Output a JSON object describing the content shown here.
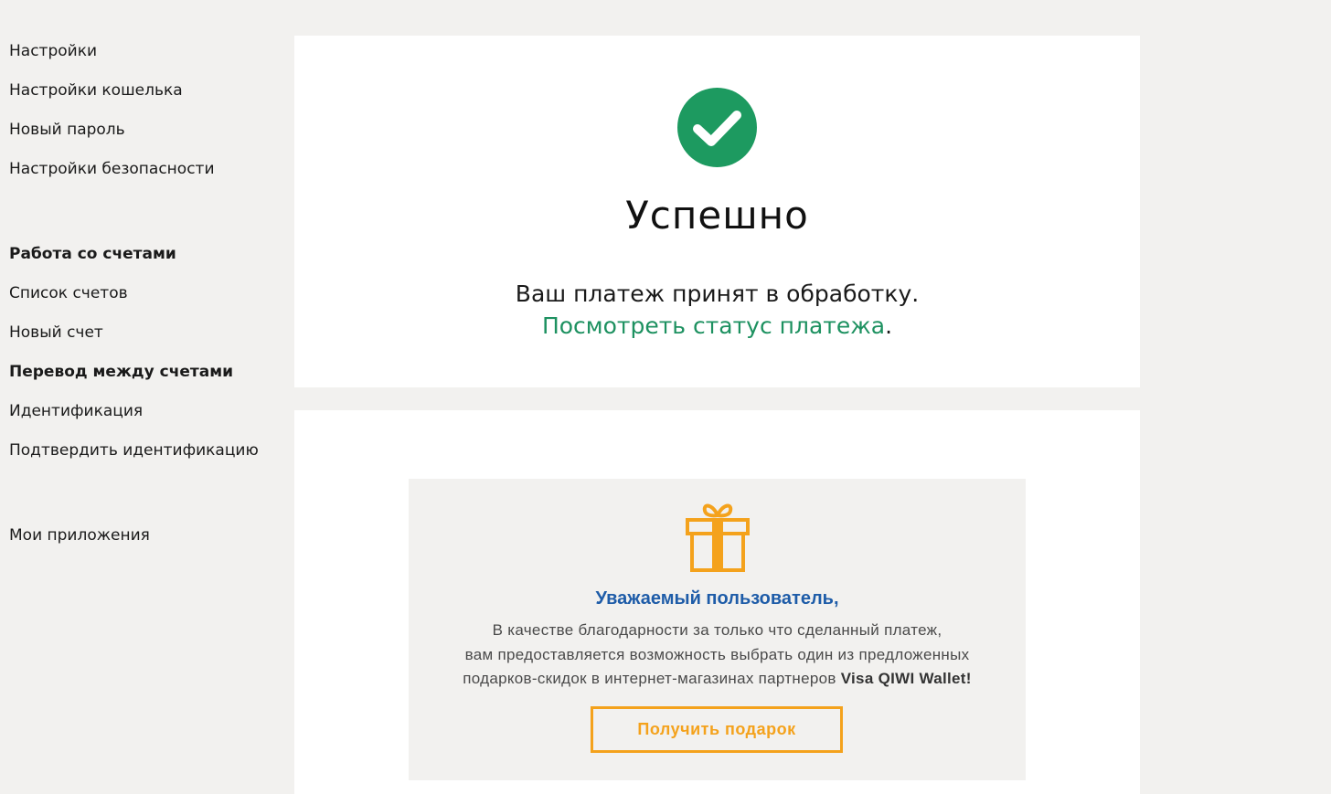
{
  "sidebar": {
    "group1": [
      {
        "label": "Настройки"
      },
      {
        "label": "Настройки кошелька"
      },
      {
        "label": "Новый пароль"
      },
      {
        "label": "Настройки безопасности"
      }
    ],
    "group2": [
      {
        "label": "Работа со счетами",
        "bold": true
      },
      {
        "label": "Список счетов"
      },
      {
        "label": "Новый счет"
      },
      {
        "label": "Перевод между счетами",
        "bold": true
      },
      {
        "label": "Идентификация"
      },
      {
        "label": "Подтвердить идентификацию"
      }
    ],
    "group3": [
      {
        "label": "Мои приложения"
      }
    ]
  },
  "success": {
    "icon": "check-circle-icon",
    "icon_color": "#1d9a60",
    "title": "Успешно",
    "message": "Ваш платеж принят в обработку.",
    "status_link": "Посмотреть статус платежа",
    "status_link_suffix": "."
  },
  "promo": {
    "icon": "gift-icon",
    "accent_color": "#f4a21c",
    "title": "Уважаемый пользователь,",
    "line1": "В качестве благодарности за только что сделанный платеж,",
    "line2": "вам предоставляется возможность выбрать один из предложенных",
    "line3": "подарков-скидок в интернет-магазинах партнеров ",
    "brand": "Visa QIWI Wallet!",
    "button_label": "Получить подарок"
  }
}
